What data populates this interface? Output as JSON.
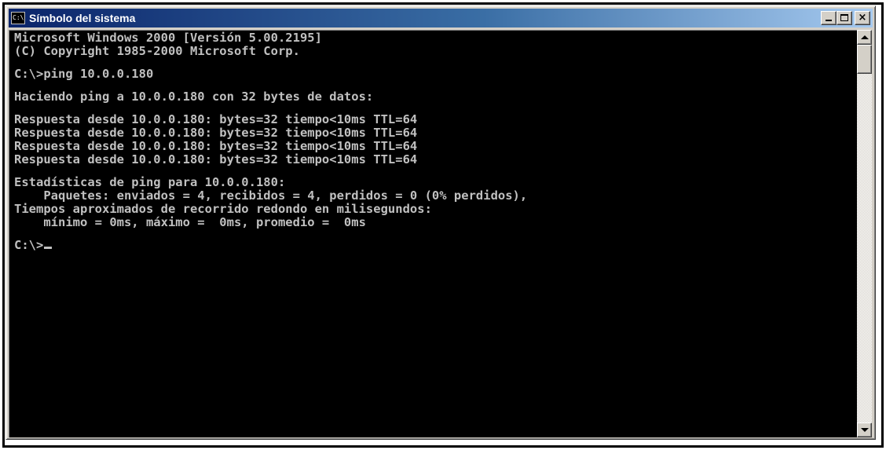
{
  "window": {
    "title": "Símbolo del sistema",
    "icon": "console-icon",
    "icon_text": "C:\\",
    "buttons": {
      "minimize": "minimize-icon",
      "maximize": "maximize-icon",
      "close": "close-icon",
      "close_glyph": "×"
    }
  },
  "console": {
    "header": [
      "Microsoft Windows 2000 [Versión 5.00.2195]",
      "(C) Copyright 1985-2000 Microsoft Corp."
    ],
    "command": "C:\\>ping 10.0.0.180",
    "pinging": "Haciendo ping a 10.0.0.180 con 32 bytes de datos:",
    "replies": [
      "Respuesta desde 10.0.0.180: bytes=32 tiempo<10ms TTL=64",
      "Respuesta desde 10.0.0.180: bytes=32 tiempo<10ms TTL=64",
      "Respuesta desde 10.0.0.180: bytes=32 tiempo<10ms TTL=64",
      "Respuesta desde 10.0.0.180: bytes=32 tiempo<10ms TTL=64"
    ],
    "stats": [
      "Estadísticas de ping para 10.0.0.180:",
      "    Paquetes: enviados = 4, recibidos = 4, perdidos = 0 (0% perdidos),",
      "Tiempos aproximados de recorrido redondo en milisegundos:",
      "    mínimo = 0ms, máximo =  0ms, promedio =  0ms"
    ],
    "prompt": "C:\\>"
  },
  "colors": {
    "console_bg": "#000000",
    "console_text": "#c0c0c0",
    "title_active_start": "#0a246a",
    "title_active_end": "#a6caf0",
    "chrome": "#d4d0c8"
  }
}
